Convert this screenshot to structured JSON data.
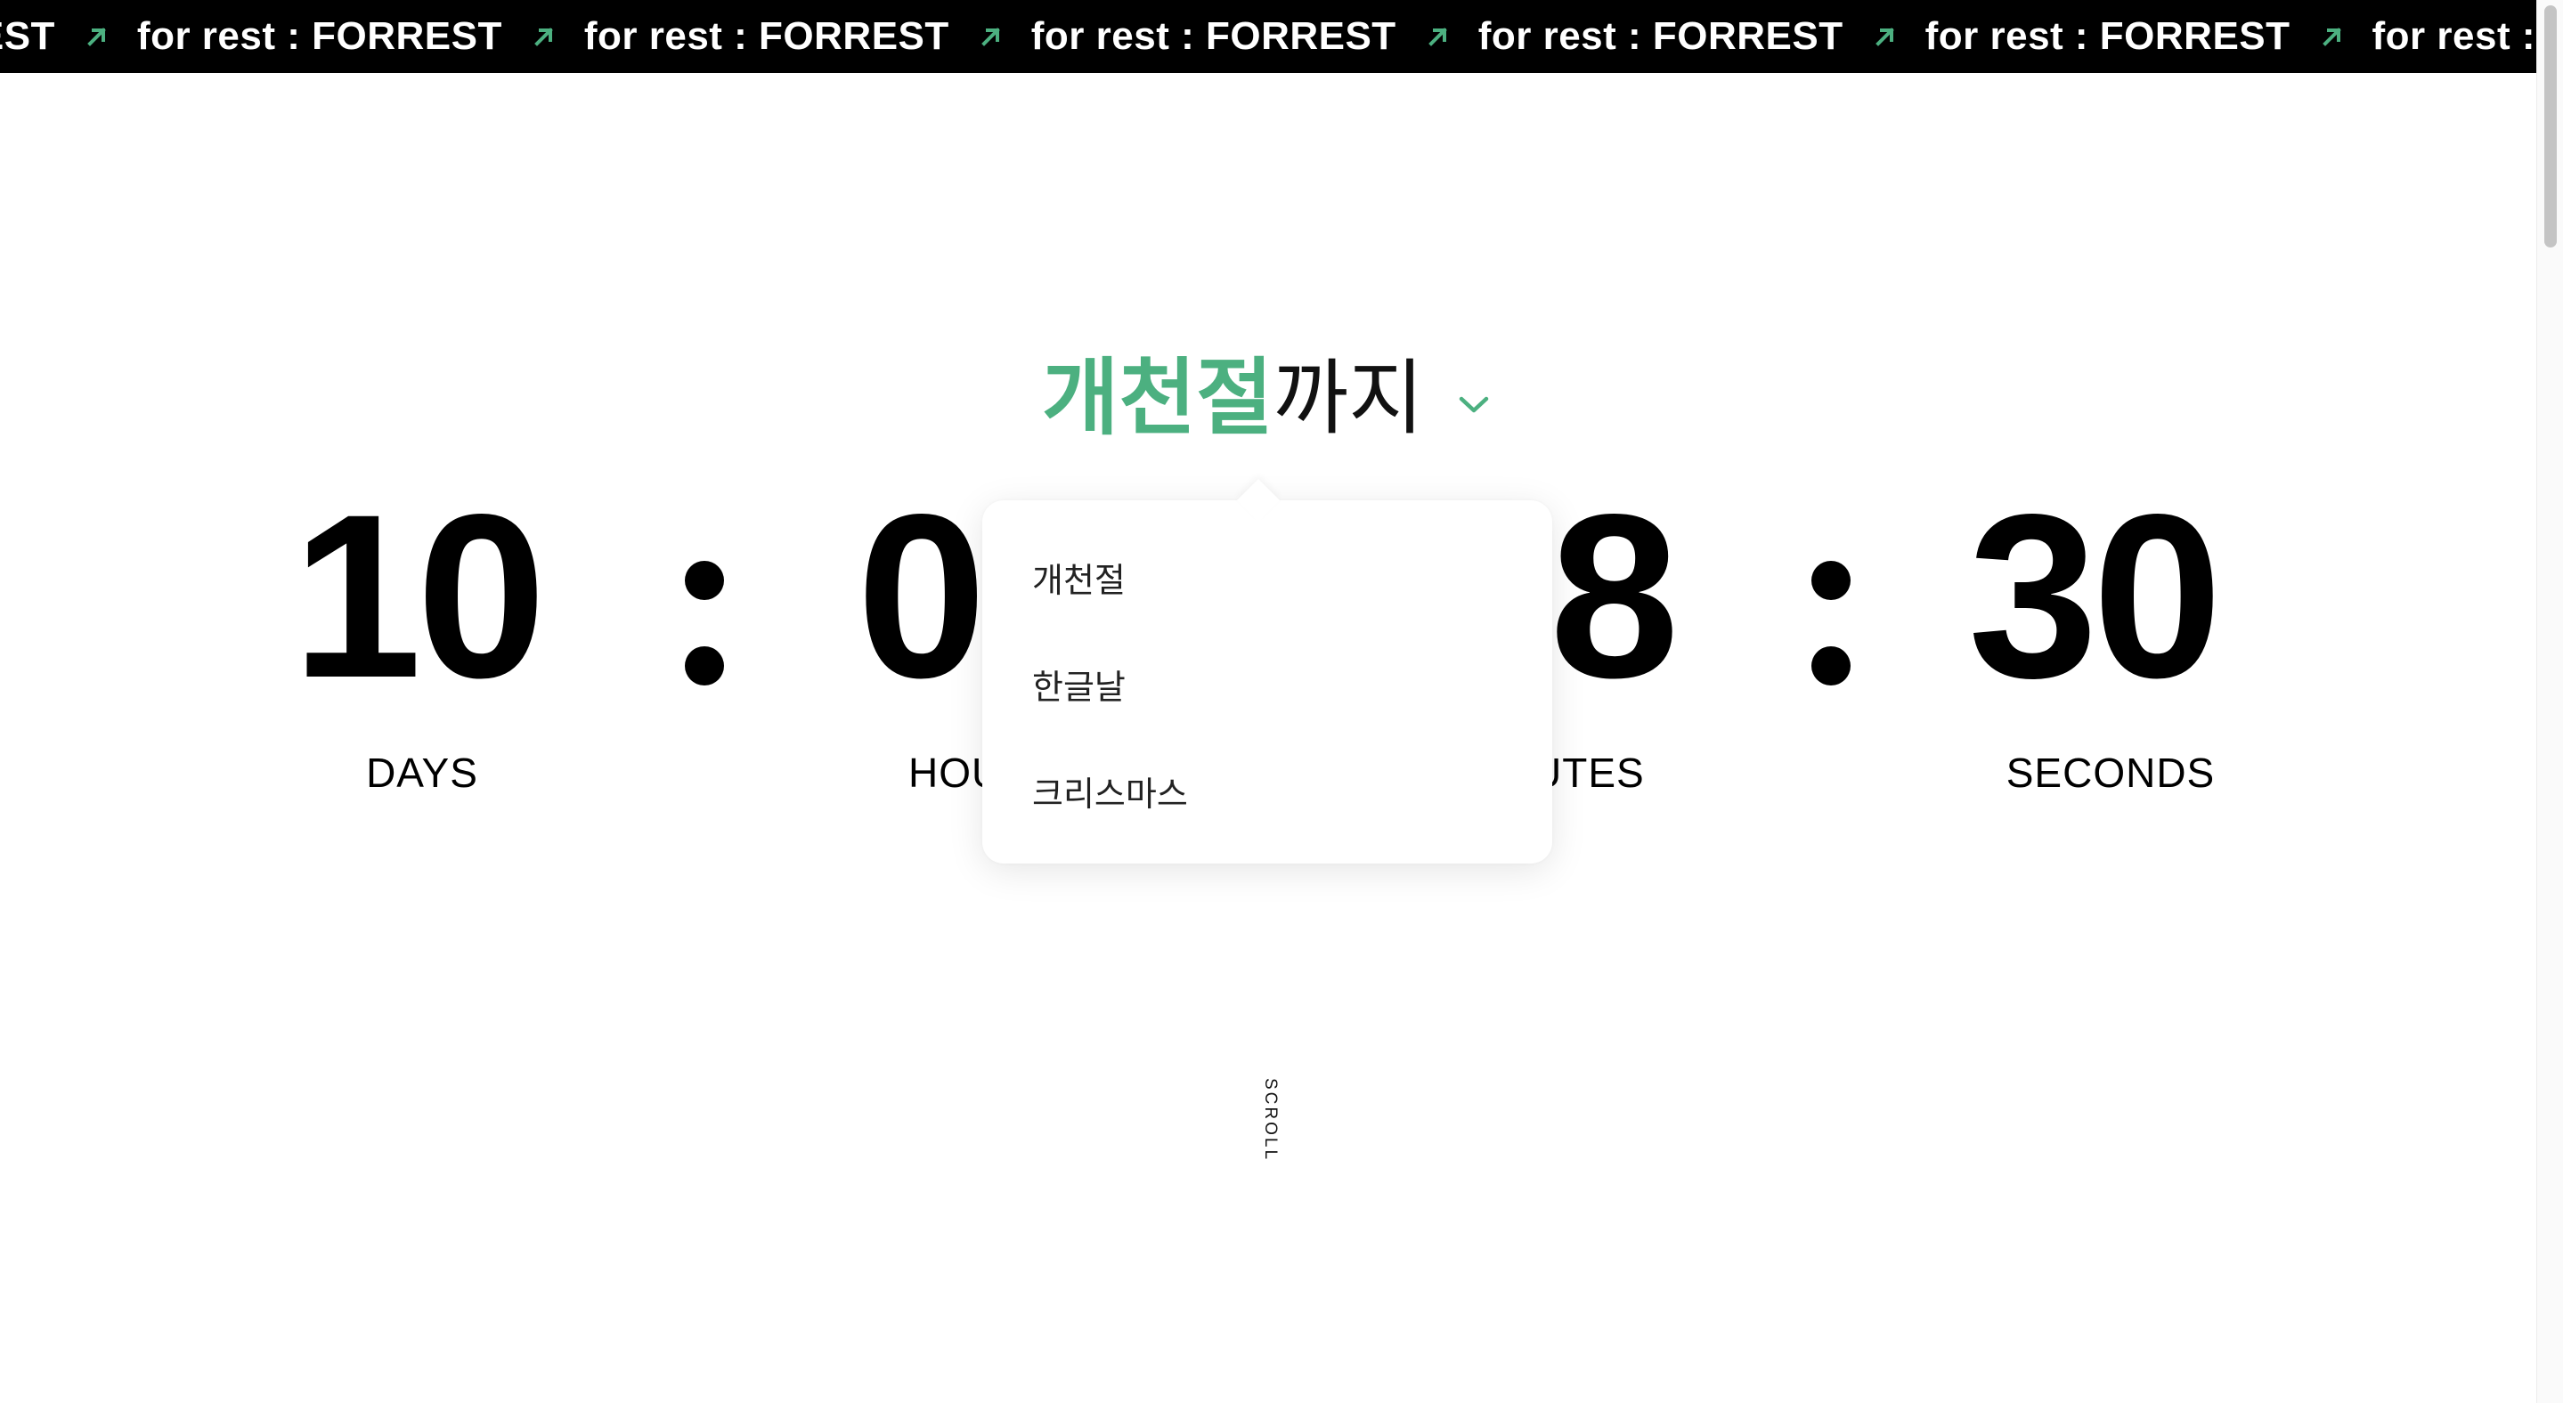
{
  "marquee": {
    "items": [
      "for rest : FORREST",
      "for rest : FORREST",
      "for rest : FORREST",
      "for rest : FORREST",
      "for rest : FORREST",
      "for rest : FORREST",
      "for rest : FORREST"
    ],
    "arrow_icon": "arrow-up-right-icon",
    "arrow_color": "#4cb080"
  },
  "heading": {
    "accent": "개천절",
    "suffix": "까지",
    "toggle_icon": "chevron-down-icon",
    "accent_color": "#4cb080"
  },
  "countdown": {
    "days": {
      "value": "10",
      "label": "DAYS"
    },
    "hours": {
      "value": "0",
      "label": "HOU"
    },
    "minutes": {
      "value": "8",
      "label": "UTES"
    },
    "seconds": {
      "value": "30",
      "label": "SECONDS"
    }
  },
  "dropdown": {
    "items": [
      "개천절",
      "한글날",
      "크리스마스"
    ]
  },
  "scroll_hint": "SCROLL"
}
